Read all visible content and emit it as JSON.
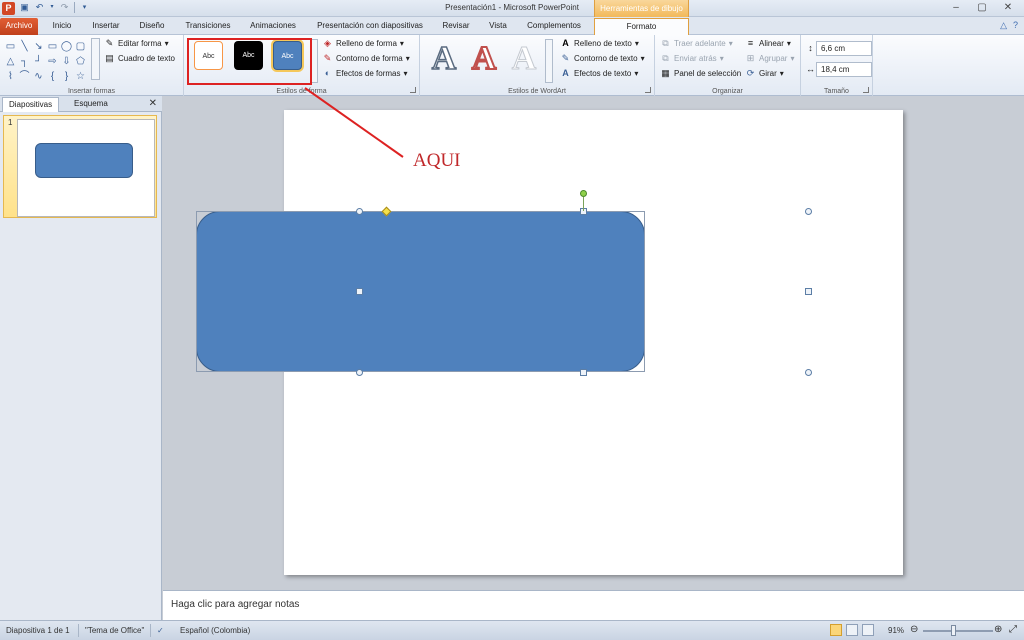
{
  "titlebar": {
    "app_icon": "P",
    "title": "Presentación1  -  Microsoft PowerPoint",
    "contextual_header": "Herramientas de dibujo",
    "controls": [
      "–",
      "▢",
      "✕"
    ]
  },
  "qat": {
    "save_icon": "save-icon",
    "undo_icon": "undo-icon",
    "redo_icon": "redo-icon"
  },
  "tabs": [
    {
      "label": "Archivo"
    },
    {
      "label": "Inicio"
    },
    {
      "label": "Insertar"
    },
    {
      "label": "Diseño"
    },
    {
      "label": "Transiciones"
    },
    {
      "label": "Animaciones"
    },
    {
      "label": "Presentación con diapositivas"
    },
    {
      "label": "Revisar"
    },
    {
      "label": "Vista"
    },
    {
      "label": "Complementos"
    },
    {
      "label": "Formato"
    }
  ],
  "ribbon": {
    "insert_shapes": {
      "edit_shape": "Editar forma",
      "text_box": "Cuadro de texto",
      "label": "Insertar formas"
    },
    "shape_styles": {
      "thumbs": [
        "Abc",
        "Abc",
        "Abc"
      ],
      "fill": "Relleno de forma",
      "outline": "Contorno de forma",
      "effects": "Efectos de formas",
      "label": "Estilos de forma"
    },
    "wordart": {
      "letters": [
        "A",
        "A",
        "A"
      ],
      "fill": "Relleno de texto",
      "outline": "Contorno de texto",
      "effects": "Efectos de texto",
      "label": "Estilos de WordArt"
    },
    "arrange": {
      "bring_forward": "Traer adelante",
      "send_backward": "Enviar atrás",
      "selection_pane": "Panel de selección",
      "align": "Alinear",
      "group": "Agrupar",
      "rotate": "Girar",
      "label": "Organizar"
    },
    "size": {
      "height": "6,6 cm",
      "width": "18,4 cm",
      "label": "Tamaño"
    }
  },
  "slides_panel": {
    "tab_slides": "Diapositivas",
    "tab_outline": "Esquema",
    "close": "✕",
    "slide_number": "1"
  },
  "annotation": {
    "text": "AQUI"
  },
  "notes": {
    "placeholder": "Haga clic para agregar notas"
  },
  "status": {
    "slide": "Diapositiva 1 de 1",
    "theme": "\"Tema de Office\"",
    "language": "Español (Colombia)",
    "zoom": "91%"
  },
  "colors": {
    "accent": "#4f81bd",
    "file_tab": "#d24726",
    "annotation": "#c0282a"
  }
}
